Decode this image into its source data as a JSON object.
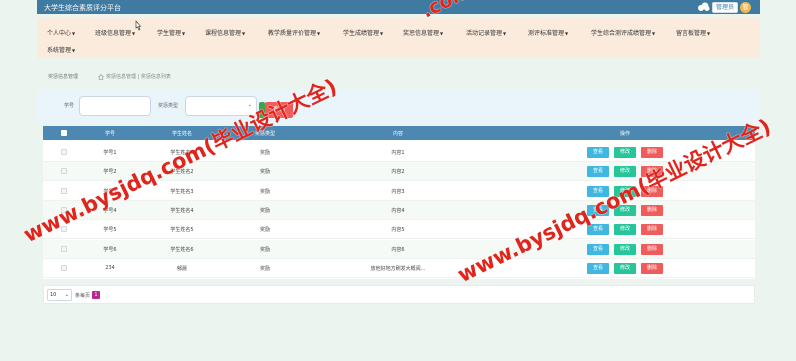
{
  "app": {
    "title": "大学生综合素质评分平台"
  },
  "user": {
    "menu_label": "管理员",
    "avatar_text": "管"
  },
  "nav": [
    {
      "label": "个人中心"
    },
    {
      "label": "班级信息管理"
    },
    {
      "label": "学生管理"
    },
    {
      "label": "课程信息管理"
    },
    {
      "label": "教学质量评价管理"
    },
    {
      "label": "学生成绩管理"
    },
    {
      "label": "奖惩信息管理"
    },
    {
      "label": "活动记录管理"
    },
    {
      "label": "测评标准管理"
    },
    {
      "label": "学生综合测评成绩管理"
    },
    {
      "label": "留言板管理"
    },
    {
      "label": "系统管理"
    }
  ],
  "breadcrumb": {
    "title": "奖惩信息管理",
    "path": "奖惩信息管理 | 奖惩信息列表"
  },
  "search": {
    "field1_label": "学号",
    "field2_label": "奖惩类型",
    "button_label": "查询"
  },
  "table": {
    "headers": [
      "学号",
      "学生姓名",
      "奖惩类型",
      "内容",
      "操作"
    ],
    "rows": [
      {
        "id": "学号1",
        "name": "学生姓名1",
        "type": "奖励",
        "content": "内容1"
      },
      {
        "id": "学号2",
        "name": "学生姓名2",
        "type": "奖励",
        "content": "内容2"
      },
      {
        "id": "学号3",
        "name": "学生姓名3",
        "type": "奖励",
        "content": "内容3"
      },
      {
        "id": "学号4",
        "name": "学生姓名4",
        "type": "奖励",
        "content": "内容4"
      },
      {
        "id": "学号5",
        "name": "学生姓名5",
        "type": "奖励",
        "content": "内容5"
      },
      {
        "id": "学号6",
        "name": "学生姓名6",
        "type": "奖励",
        "content": "内容6"
      },
      {
        "id": "234",
        "name": "郁晨",
        "type": "奖励",
        "content": "放他好地方刷发大概阅..."
      }
    ],
    "actions": {
      "view": "查看",
      "edit": "修改",
      "delete": "删除"
    }
  },
  "pager": {
    "page_size": "10",
    "page_size_label": "条每页",
    "current_page": "1"
  },
  "watermarks": [
    {
      "text": "www.bysjdq.com(毕业设计大全)"
    },
    {
      "text": "www.bysjdq.com(毕业设计大全)"
    },
    {
      "text": "www.bysjdq.com(毕业设计大全)"
    }
  ],
  "colors": {
    "header": "#3f7ba0",
    "nav_bg": "#fbebdd",
    "table_head": "#4c88b2",
    "view": "#3fb7e0",
    "edit": "#27c59a",
    "delete": "#f05b5b",
    "watermark": "#e0251c"
  }
}
